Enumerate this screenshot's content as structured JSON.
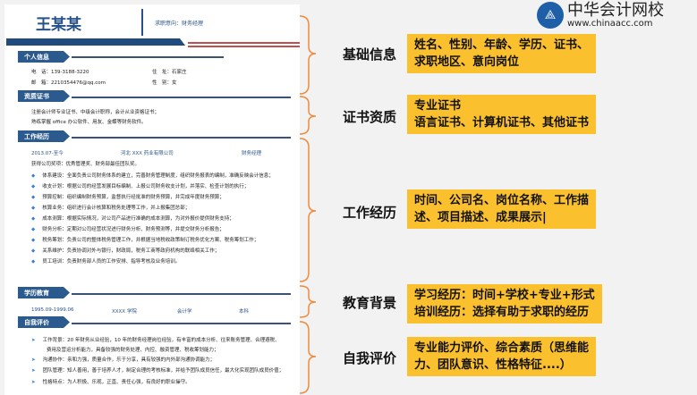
{
  "resume": {
    "name": "王某某",
    "intent": "求职意向：财务经理",
    "sections": {
      "personal": "个人信息",
      "cert": "资质证书",
      "work": "工作经历",
      "edu": "学历教育",
      "self": "自我评价"
    },
    "personal": {
      "phone": "电　话：139-3188-3220",
      "email": "邮　箱：2210354476@qq.com",
      "address": "住　址：石家庄",
      "gender": "性　别：女"
    },
    "cert": [
      "注册会计师专业证书、中级会计职称，会计从业资格证书；",
      "熟练掌握 office 办公软件、用友、金蝶等财务软件。"
    ],
    "work": {
      "period": "2013.07-至今",
      "company": "河北 XXX 药业有限公司",
      "title": "财务经理",
      "award": "获得公司奖项：优秀管理奖、财务部最佳团队奖。",
      "items": [
        "体系建设：全面负责公司财务体系的建立，完善财务管理制度，组织财务报表的编制，准确反映会计信息；",
        "收支计划：根据公司的经营发展目标编制、上报公司财务收支计划，并落实、检查计划的执行；",
        "预算控制：组织编制财务预算，监督执行经批准的财务预算，并完成年度财务预算；",
        "核算业务：组织进行会计核算和税务处理等工作，并上报集团总部；",
        "成本测算：根据实际情况，对公司产品进行准确的成本测算，为对外报价提供财务支持；",
        "财务分析：定期对公司经营状况进行财务分析、财务预测等，并提交财务分析报告；",
        "税务筹划：负责公司的整体税务管理工作，并根据当地税收政策制订税务优化方案、税务筹划工作；",
        "关系维护：负责协调对外与银行，财政局，税务工商等政府机构的联络相关工作；",
        "员工培训：负责财务部人员的工作安排、指导考核及业务培训。"
      ]
    },
    "edu": {
      "period": "1995.09-1999.06",
      "school": "XXXX 学院",
      "major": "会计学",
      "degree": "本科"
    },
    "self": [
      "工作背景：20 年财务从业经验，10 年的财务经理岗位经验，有丰富的成本分析、往来账务管理、合理避税、",
      "费用及营运分析能力，具备较强的财务处理、内控、融资管理、税收筹划能力；",
      "沟通协作：亲和力强，质量合作，乐于分享，具有较强的内外部沟通协调能力；",
      "团队管理：知人善用，善于培养人才，制定合理的考核标准，并给予团队成员信任，最大化实现团队成员价值；",
      "性格特点：为人积极、乐观，正直、责任心强，有良好的职业操守。"
    ]
  },
  "annotations": [
    {
      "label": "基础信息",
      "text": "姓名、性别、年龄、学历、证书、\n求职地区、意向岗位"
    },
    {
      "label": "证书资质",
      "text": "专业证书\n语言证书、计算机证书、其他证书"
    },
    {
      "label": "工作经历",
      "text": "时间、公司名、岗位名称、工作描\n述、项目描述、成果展示|"
    },
    {
      "label": "教育背景",
      "text": "学习经历：时间+学校+专业+形式\n培训经历：选择有助于求职的经历"
    },
    {
      "label": "自我评价",
      "text": "专业能力评价、综合素质（思维能\n力、团队意识、性格特征....）"
    }
  ],
  "logo": {
    "name": "中华会计网校",
    "url": "www.chinaacc.com"
  },
  "colors": {
    "accent": "#fbc02d",
    "bracket": "#f08a3c",
    "navy": "#27518a"
  }
}
